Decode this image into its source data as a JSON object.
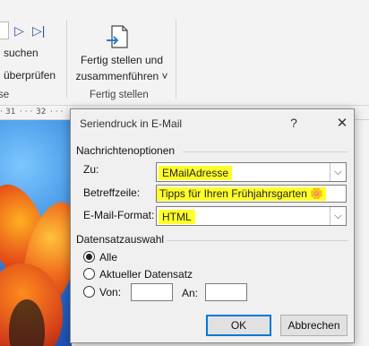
{
  "ribbon": {
    "search_label": "suchen",
    "check_label": "überprüfen",
    "group_left_tail": "se",
    "finish_button_line1": "Fertig stellen und",
    "finish_button_line2": "zusammenführen ˅",
    "finish_group_label": "Fertig stellen"
  },
  "ruler": {
    "mark_31": "31",
    "mark_32": "32"
  },
  "dialog": {
    "title": "Seriendruck in E-Mail",
    "help": "?",
    "close": "✕",
    "message_options": {
      "heading": "Nachrichtenoptionen",
      "to_label": "Zu:",
      "to_value": "EMailAdresse",
      "subject_label": "Betreffzeile:",
      "subject_value": "Tipps für Ihren Frühjahrsgarten 🌼",
      "format_label": "E-Mail-Format:",
      "format_value": "HTML"
    },
    "records": {
      "heading": "Datensatzauswahl",
      "all_label": "Alle",
      "current_label": "Aktueller Datensatz",
      "from_label": "Von:",
      "to_label": "An:",
      "from_value": "",
      "to_value": "",
      "selected": "Alle"
    },
    "ok_label": "OK",
    "cancel_label": "Abbrechen"
  }
}
